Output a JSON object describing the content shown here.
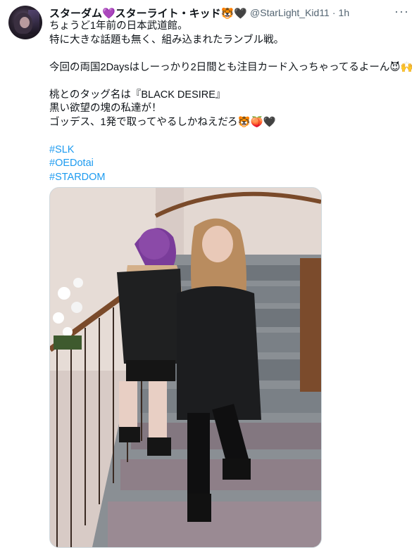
{
  "author": {
    "display_name": "スターダム💜スターライト・キッド🐯🖤",
    "handle": "@StarLight_Kid11",
    "separator": "·",
    "time": "1h"
  },
  "more_menu": "···",
  "tweet_text": {
    "line1": "ちょうど1年前の日本武道館。",
    "line2": "特に大きな話題も無く、組み込まれたランブル戦。",
    "line3": "今回の両国2Daysはしーっかり2日間とも注目カード入っちゃってるよーん😈🙌",
    "line4": "桃とのタッグ名は『BLACK DESIRE』",
    "line5": "黒い欲望の塊の私達が！",
    "line6": "ゴッデス、1発で取ってやるしかねえだろ🐯🍑🖤"
  },
  "hashtags": [
    "#SLK",
    "#OEDotai",
    "#STARDOM"
  ],
  "colors": {
    "link": "#1d9bf0",
    "muted": "#536471",
    "text": "#0f1419"
  }
}
